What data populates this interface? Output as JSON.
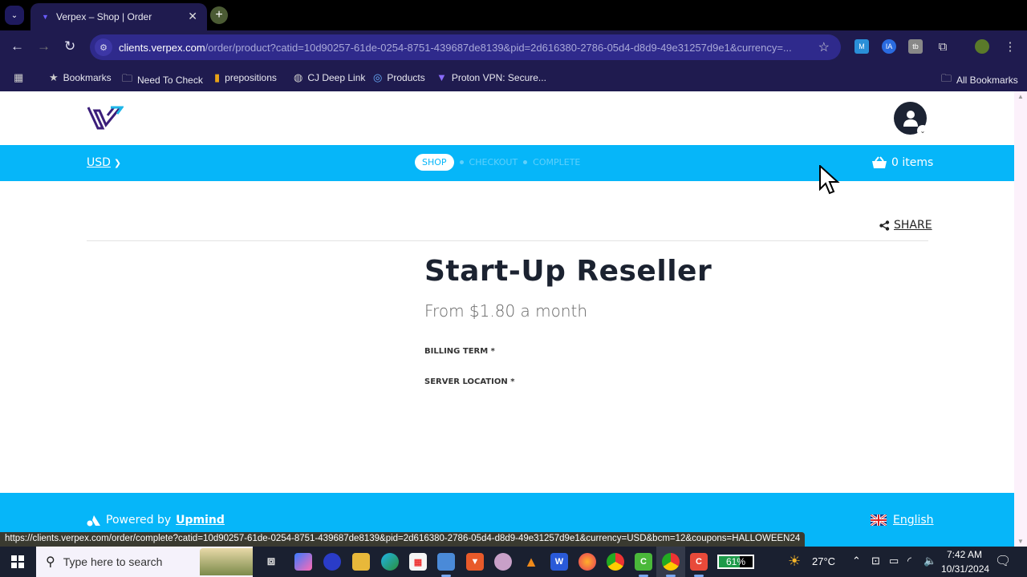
{
  "browser": {
    "tab_title": "Verpex – Shop | Order",
    "url_host": "clients.verpex.com",
    "url_path": "/order/product?catid=10d90257-61de-0254-8751-439687de8139&pid=2d616380-2786-05d4-d8d9-49e31257d9e1&currency=...",
    "bookmarks": [
      {
        "label": "Bookmarks",
        "icon": "star-icon"
      },
      {
        "label": "Need To Check",
        "icon": "folder-icon"
      },
      {
        "label": "prepositions",
        "icon": "bookmark-favicon"
      },
      {
        "label": "CJ Deep Link",
        "icon": "globe-icon"
      },
      {
        "label": "Products",
        "icon": "product-favicon"
      },
      {
        "label": "Proton VPN: Secure...",
        "icon": "proton-vpn-icon"
      }
    ],
    "all_bookmarks": "All Bookmarks",
    "status_url": "https://clients.verpex.com/order/complete?catid=10d90257-61de-0254-8751-439687de8139&pid=2d616380-2786-05d4-d8d9-49e31257d9e1&currency=USD&bcm=12&coupons=HALLOWEEN24"
  },
  "site": {
    "currency": "USD",
    "steps": [
      "SHOP",
      "CHECKOUT",
      "COMPLETE"
    ],
    "active_step": "SHOP",
    "cart": "0 items",
    "share": "SHARE",
    "product_title": "Start-Up Reseller",
    "price": "From $1.80 a month",
    "fields": [
      "BILLING TERM *",
      "SERVER LOCATION *"
    ],
    "powered_prefix": "Powered by",
    "powered_link": "Upmind",
    "language": "English",
    "colors": {
      "brand_blue": "#06b6f9",
      "dark": "#1b2230"
    }
  },
  "taskbar": {
    "search_placeholder": "Type here to search",
    "battery": "61%",
    "battery_level": 0.61,
    "weather": "27°C",
    "time": "7:42 AM",
    "date": "10/31/2024"
  }
}
